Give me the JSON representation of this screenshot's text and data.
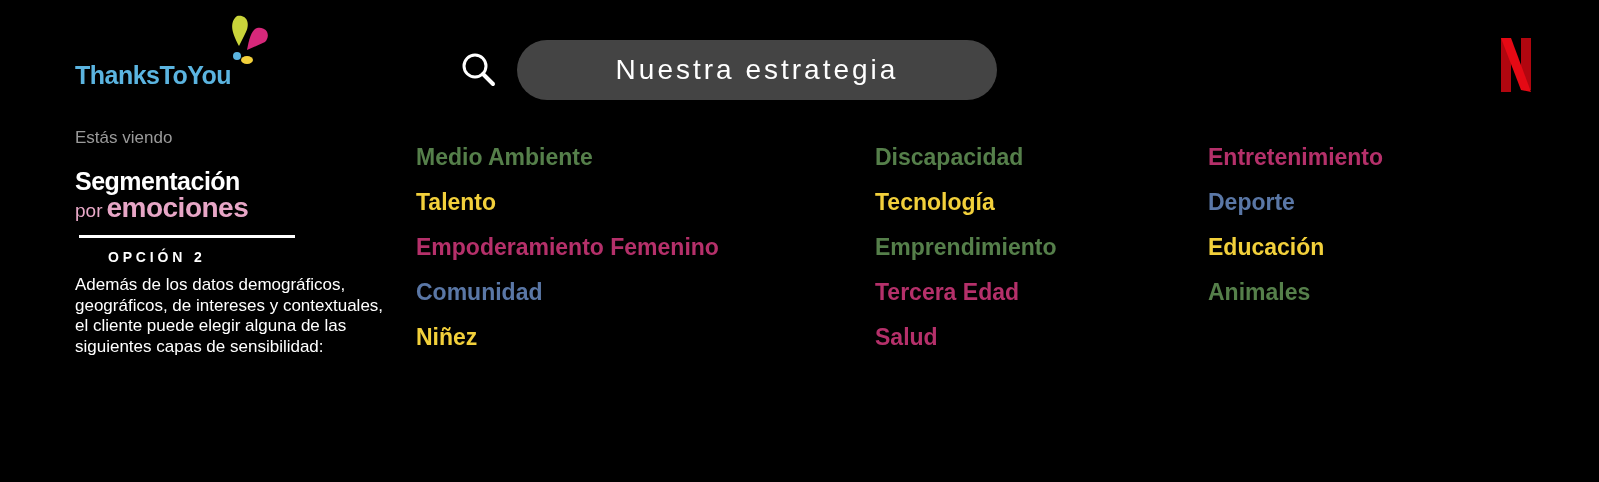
{
  "brand": {
    "name": "ThanksToYou"
  },
  "sidebar": {
    "eyebrow": "Estás viendo",
    "title": {
      "line1": "Segmentación",
      "prefix": "por",
      "emphasis": "emociones"
    },
    "option": "O P C I Ó N   2",
    "description": "Además de los datos demográficos, geográficos, de intereses y contextuales, el cliente puede elegir alguna de las siguientes capas de sensibilidad:"
  },
  "search": {
    "value": "Nuestra estrategia"
  },
  "tag_columns": [
    {
      "items": [
        {
          "label": "Medio Ambiente",
          "color": "#557f4a"
        },
        {
          "label": "Talento",
          "color": "#f2d03b"
        },
        {
          "label": "Empoderamiento Femenino",
          "color": "#b5306a"
        },
        {
          "label": "Comunidad",
          "color": "#5a77a6"
        },
        {
          "label": "Niñez",
          "color": "#f2d03b"
        }
      ]
    },
    {
      "items": [
        {
          "label": "Discapacidad",
          "color": "#557f4a"
        },
        {
          "label": "Tecnología",
          "color": "#f2d03b"
        },
        {
          "label": "Emprendimiento",
          "color": "#557f4a"
        },
        {
          "label": "Tercera Edad",
          "color": "#b5306a"
        },
        {
          "label": "Salud",
          "color": "#b5306a"
        }
      ]
    },
    {
      "items": [
        {
          "label": "Entretenimiento",
          "color": "#b5306a"
        },
        {
          "label": "Deporte",
          "color": "#5a77a6"
        },
        {
          "label": "Educación",
          "color": "#f2d03b"
        },
        {
          "label": "Animales",
          "color": "#557f4a"
        }
      ]
    }
  ]
}
